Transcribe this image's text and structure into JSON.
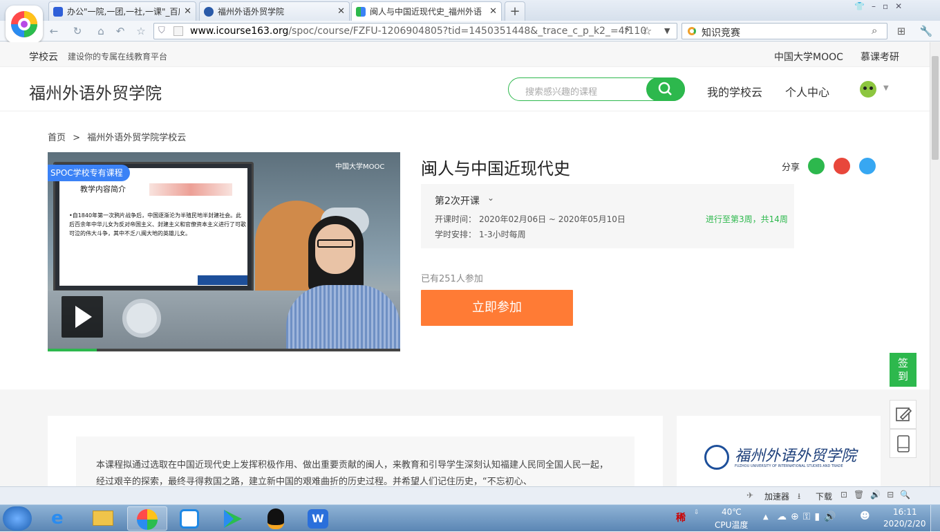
{
  "browser": {
    "tabs": [
      {
        "title": "办公\"一院,一团,一社,一课\"_百度",
        "active": false
      },
      {
        "title": "福州外语外贸学院",
        "active": false
      },
      {
        "title": "闽人与中国近现代史_福州外语",
        "active": true
      }
    ],
    "new_tab_label": "+",
    "url_domain": "www.icourse163.org",
    "url_path": "/spoc/course/FZFU-1206904805?tid=1450351448&_trace_c_p_k2_=4f110",
    "search_value": "知识竞赛"
  },
  "topstrip": {
    "brand": "学校云",
    "slogan": "建设你的专属在线教育平台",
    "links": [
      "中国大学MOOC",
      "慕课考研"
    ]
  },
  "header": {
    "school": "福州外语外贸学院",
    "search_placeholder": "搜索感兴趣的课程",
    "nav": [
      "我的学校云",
      "个人中心"
    ]
  },
  "breadcrumb": {
    "home": "首页",
    "sep": ">",
    "current": "福州外语外贸学院学校云"
  },
  "video": {
    "badge": "SPOC学校专有课程",
    "watermark": "中国大学MOOC",
    "slide_title": "教学内容简介",
    "slide_text": "•自1840年第一次鸦片战争后，中国逐渐沦为半殖民地半封建社会。此后百余年中华儿女为反对帝国主义、封建主义和官僚资本主义进行了可歌可泣的伟大斗争，其中不乏八闽大地的英雄儿女。",
    "progress": 0.14
  },
  "course": {
    "title": "闽人与中国近现代史",
    "share_label": "分享",
    "session": "第2次开课",
    "time_label": "开课时间：",
    "time_value": "2020年02月06日 ~ 2020年05月10日",
    "progress_text": "进行至第3周，共14周",
    "hours_label": "学时安排：",
    "hours_value": "1-3小时每周",
    "joined": "已有251人参加",
    "join_button": "立即参加"
  },
  "sidebar": {
    "sign": "签到"
  },
  "description": "本课程拟通过选取在中国近现代史上发挥积极作用、做出重要贡献的闽人，来教育和引导学生深刻认知福建人民同全国人民一起，经过艰辛的探索，最终寻得救国之路，建立新中国的艰难曲折的历史过程。并希望人们记住历史，“不忘初心、",
  "school_card": {
    "name_script": "福州外语外贸学院",
    "name_en": "FUZHOU UNIVERSITY OF INTERNATIONAL STUDIES AND TRADE"
  },
  "statusbar": {
    "items": [
      "加速器",
      "下载"
    ]
  },
  "taskbar": {
    "temp": "40℃",
    "cpu": "CPU温度",
    "time": "16:11",
    "date": "2020/2/20",
    "ime": "稀"
  },
  "colors": {
    "green": "#2db84d",
    "orange": "#ff7b35",
    "badge": "#3b82f6"
  }
}
